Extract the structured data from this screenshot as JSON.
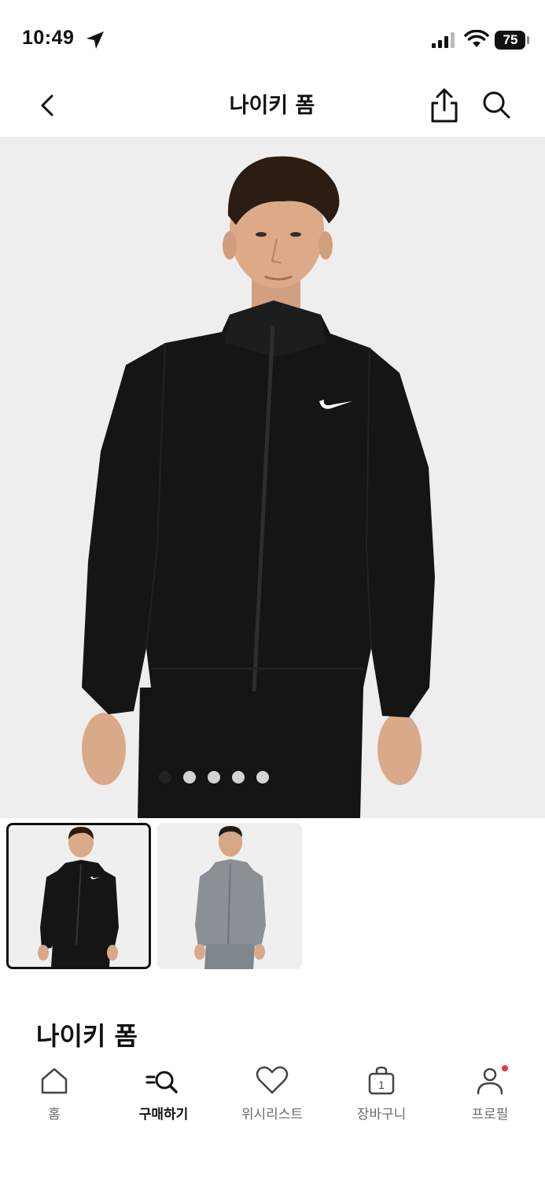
{
  "status_bar": {
    "time": "10:49",
    "battery": "75",
    "icons": [
      "location-arrow-icon",
      "signal-icon",
      "wifi-icon",
      "battery-icon"
    ]
  },
  "header": {
    "title": "나이키 폼",
    "left_icon": "chevron-left-icon",
    "right_icons": [
      "share-icon",
      "search-icon"
    ]
  },
  "gallery": {
    "dot_count": 5,
    "active_index": 0,
    "thumbnails": [
      {
        "color": "black",
        "selected": true
      },
      {
        "color": "gray",
        "selected": false
      }
    ]
  },
  "product": {
    "title": "나이키 폼"
  },
  "tabbar": {
    "items": [
      {
        "label": "홈",
        "icon": "home-icon",
        "active": false
      },
      {
        "label": "구매하기",
        "icon": "shop-search-icon",
        "active": true
      },
      {
        "label": "위시리스트",
        "icon": "heart-icon",
        "active": false
      },
      {
        "label": "장바구니",
        "icon": "bag-icon",
        "active": false,
        "badge": "1"
      },
      {
        "label": "프로필",
        "icon": "profile-icon",
        "active": false,
        "has_notification": true
      }
    ]
  },
  "colors": {
    "background": "#ffffff",
    "hero_bg": "#eeeeee",
    "text": "#111111",
    "muted_text": "#6b6b6b",
    "notification": "#e23b3b",
    "jacket_black": "#151515",
    "jacket_gray": "#8a9096"
  }
}
